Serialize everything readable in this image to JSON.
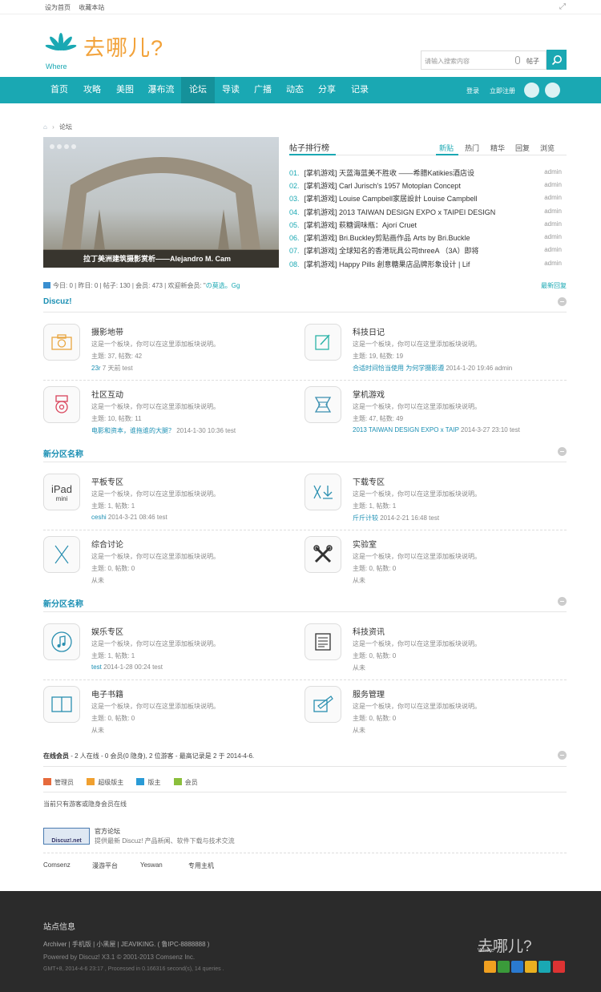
{
  "topbar": {
    "set_home": "设为首页",
    "bookmark": "收藏本站"
  },
  "logo": {
    "where": "Where",
    "text": "去哪儿?"
  },
  "search": {
    "placeholder": "请输入搜索内容",
    "scope": "帖子"
  },
  "nav": {
    "items": [
      "首页",
      "攻略",
      "美图",
      "瀑布流",
      "论坛",
      "导读",
      "广播",
      "动态",
      "分享",
      "记录"
    ],
    "active_index": 4,
    "login": "登录",
    "register": "立即注册"
  },
  "breadcrumb": {
    "current": "论坛"
  },
  "slide": {
    "caption": "拉丁美洲建筑摄影赏析——Alejandro M. Cam"
  },
  "ranking": {
    "title": "帖子排行榜",
    "tabs": [
      "新贴",
      "热门",
      "精华",
      "回复",
      "浏览"
    ],
    "active_tab": 0,
    "rows": [
      {
        "num": "01.",
        "title": "[掌机游戏] 天蓝海蓝美不胜收 ——希腊Katikies酒店设",
        "author": "admin"
      },
      {
        "num": "02.",
        "title": "[掌机游戏] Carl Jurisch's 1957 Motoplan Concept",
        "author": "admin"
      },
      {
        "num": "03.",
        "title": "[掌机游戏] Louise Campbell家居設計 Louise Campbell",
        "author": "admin"
      },
      {
        "num": "04.",
        "title": "[掌机游戏] 2013 TAIWAN DESIGN EXPO x TAIPEI DESIGN",
        "author": "admin"
      },
      {
        "num": "05.",
        "title": "[掌机游戏] 萩糖调味瓶：Ajorí Cruet",
        "author": "admin"
      },
      {
        "num": "06.",
        "title": "[掌机游戏] Bri.Buckley剪贴画作品 Arts by Bri.Buckle",
        "author": "admin"
      },
      {
        "num": "07.",
        "title": "[掌机游戏] 全球知名的香港玩具公司threeA （3A）即将",
        "author": "admin"
      },
      {
        "num": "08.",
        "title": "[掌机游戏] Happy Pills 創意糖果店品牌形象设计 | Lif",
        "author": "admin"
      }
    ]
  },
  "stats": {
    "text": "今日: 0 | 昨日: 0 | 帖子: 130 | 会员: 473 | 欢迎新会员: \"",
    "newest": "の莫选。Gg",
    "latest_reply": "最新回复"
  },
  "sections": [
    {
      "title": "Discuz!",
      "forums": [
        {
          "name": "摄影地带",
          "desc": "这是一个板块，你可以在这里添加板块说明。",
          "counts": "主题: 37, 帖数: 42",
          "last_link": "23r",
          "last_rest": " 7 天前 test"
        },
        {
          "name": "科技日记",
          "desc": "这是一个板块，你可以在这里添加板块说明。",
          "counts": "主题: 19, 帖数: 19",
          "last_link": "合适时间恰当使用 为何学摄影遵",
          "last_rest": " 2014-1-20 19:46 admin"
        },
        {
          "name": "社区互动",
          "desc": "这是一个板块，你可以在这里添加板块说明。",
          "counts": "主题: 10, 帖数: 11",
          "last_link": "电影和资本，谁拖谁的大腿？",
          "last_rest": " 2014-1-30 10:36 test"
        },
        {
          "name": "掌机游戏",
          "desc": "这是一个板块，你可以在这里添加板块说明。",
          "counts": "主题: 47, 帖数: 49",
          "last_link": "2013 TAIWAN DESIGN EXPO x TAIP",
          "last_rest": " 2014-3-27 23:10 test"
        }
      ]
    },
    {
      "title": "新分区名称",
      "forums": [
        {
          "name": "平板专区",
          "desc": "这是一个板块，你可以在这里添加板块说明。",
          "counts": "主题: 1, 帖数: 1",
          "last_link": "ceshi",
          "last_rest": " 2014-3-21 08:46 test"
        },
        {
          "name": "下载专区",
          "desc": "这是一个板块，你可以在这里添加板块说明。",
          "counts": "主题: 1, 帖数: 1",
          "last_link": "斤斤计较",
          "last_rest": " 2014-2-21 16:48 test"
        },
        {
          "name": "综合讨论",
          "desc": "这是一个板块，你可以在这里添加板块说明。",
          "counts": "主题: 0, 帖数: 0",
          "last_link": "",
          "last_rest": "从未"
        },
        {
          "name": "实验室",
          "desc": "这是一个板块，你可以在这里添加板块说明。",
          "counts": "主题: 0, 帖数: 0",
          "last_link": "",
          "last_rest": "从未"
        }
      ]
    },
    {
      "title": "新分区名称",
      "forums": [
        {
          "name": "娱乐专区",
          "desc": "这是一个板块，你可以在这里添加板块说明。",
          "counts": "主题: 1, 帖数: 1",
          "last_link": "test",
          "last_rest": " 2014-1-28 00:24 test"
        },
        {
          "name": "科技资讯",
          "desc": "这是一个板块，你可以在这里添加板块说明。",
          "counts": "主题: 0, 帖数: 0",
          "last_link": "",
          "last_rest": "从未"
        },
        {
          "name": "电子书籍",
          "desc": "这是一个板块，你可以在这里添加板块说明。",
          "counts": "主题: 0, 帖数: 0",
          "last_link": "",
          "last_rest": "从未"
        },
        {
          "name": "服务管理",
          "desc": "这是一个板块，你可以在这里添加板块说明。",
          "counts": "主题: 0, 帖数: 0",
          "last_link": "",
          "last_rest": "从未"
        }
      ]
    }
  ],
  "online": {
    "label": "在线会员",
    "text": " - 2 人在线 - 0 会员(0 隐身), 2 位游客 - 最高记录是 2 于 2014-4-6.",
    "legend": [
      "管理员",
      "超级版主",
      "版主",
      "会员"
    ],
    "legend_colors": [
      "#e66a3c",
      "#f0a030",
      "#2a9bd6",
      "#8bbf3c"
    ],
    "note": "当前只有游客或隐身会员在线"
  },
  "official": {
    "logo_text": "Discuz!.net",
    "title": "官方论坛",
    "desc": "提供最新 Discuz! 产品新闻、软件下载与技术交流"
  },
  "links": [
    "Comsenz",
    "漫游平台",
    "Yeswan",
    "专用主机"
  ],
  "footer": {
    "title": "站点信息",
    "line1": "Archiver | 手机版 | 小黑屋 | JEAVIKING. ( 鲁IPC-8888888 )",
    "line2": "Powered by Discuz! X3.1 © 2001-2013 Comsenz Inc.",
    "line3": "GMT+8, 2014-4-6 23:17 , Processed in 0.166316 second(s), 14 queries .",
    "logo_text": "去哪儿?",
    "logo_where": "Where",
    "social_colors": [
      "#f0a020",
      "#3a9a3a",
      "#2a7ad0",
      "#e9b020",
      "#1aa8b3",
      "#d33"
    ]
  }
}
